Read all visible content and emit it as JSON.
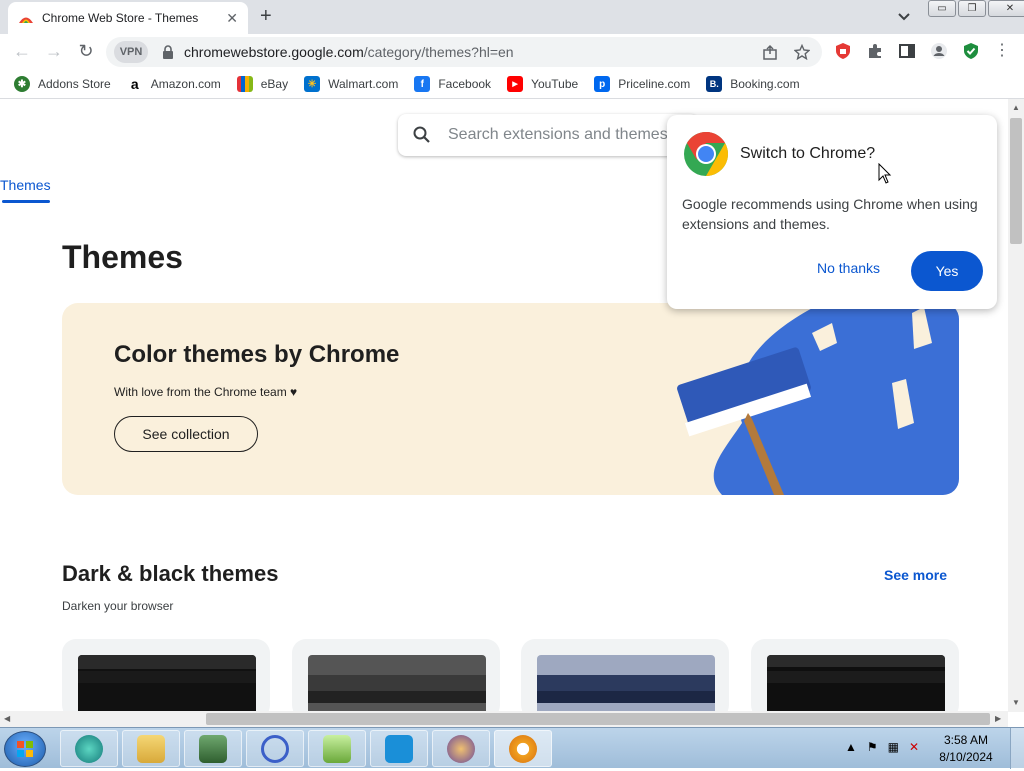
{
  "tab": {
    "title": "Chrome Web Store - Themes",
    "close": "✕"
  },
  "newtab": "+",
  "window_controls": {
    "minimize": "▭",
    "restore": "❐",
    "close": "✕"
  },
  "toolbar": {
    "back": "←",
    "forward": "→",
    "reload": "↻",
    "vpn": "VPN",
    "url_host": "chromewebstore.google.com",
    "url_path": "/category/themes?hl=en"
  },
  "bookmarks": [
    {
      "label": "Addons Store",
      "icon": "addons-store-icon",
      "color": "#2e7d32",
      "glyph": "✱"
    },
    {
      "label": "Amazon.com",
      "icon": "amazon-icon",
      "color": "#ffffff",
      "glyph": "a"
    },
    {
      "label": "eBay",
      "icon": "ebay-icon",
      "color": "#333333",
      "glyph": "e"
    },
    {
      "label": "Walmart.com",
      "icon": "walmart-icon",
      "color": "#0071ce",
      "glyph": "✳"
    },
    {
      "label": "Facebook",
      "icon": "facebook-icon",
      "color": "#1877f2",
      "glyph": "f"
    },
    {
      "label": "YouTube",
      "icon": "youtube-icon",
      "color": "#ff0000",
      "glyph": "▶"
    },
    {
      "label": "Priceline.com",
      "icon": "priceline-icon",
      "color": "#0068ef",
      "glyph": "p"
    },
    {
      "label": "Booking.com",
      "icon": "booking-icon",
      "color": "#003580",
      "glyph": "B."
    }
  ],
  "search": {
    "placeholder": "Search extensions and themes"
  },
  "nav": {
    "themes_tab": "Themes"
  },
  "page_title": "Themes",
  "hero": {
    "title": "Color themes by Chrome",
    "subtitle": "With love from the Chrome team ♥",
    "button": "See collection"
  },
  "section": {
    "title": "Dark & black themes",
    "subtitle": "Darken your browser",
    "see_more": "See more"
  },
  "popup": {
    "title": "Switch to Chrome?",
    "body": "Google recommends using Chrome when using extensions and themes.",
    "no_thanks": "No thanks",
    "yes": "Yes"
  },
  "taskbar": {
    "time": "3:58 AM",
    "date": "8/10/2024"
  },
  "colors": {
    "accent": "#0b57d0",
    "hero_bg": "#faf0dc",
    "brush_blue": "#3b6fd6"
  }
}
